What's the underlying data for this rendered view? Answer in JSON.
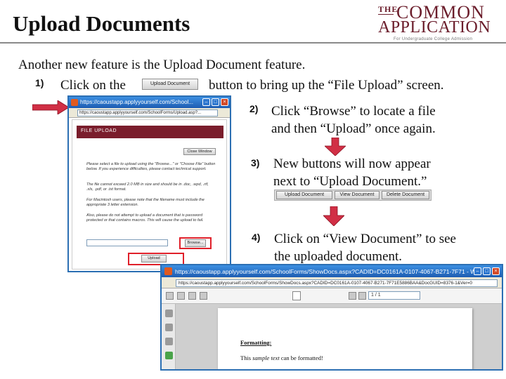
{
  "slide": {
    "title": "Upload Documents",
    "intro": "Another new feature is the Upload Document feature.",
    "step1": {
      "number": "1)",
      "text_before": "Click on the",
      "button_label": "Upload Document",
      "text_after": "button to bring up the “File Upload” screen."
    },
    "step2": {
      "number": "2)",
      "line1": "Click “Browse” to locate a file",
      "line2": "and then “Upload” once again."
    },
    "step3": {
      "number": "3)",
      "line1": "New buttons will now appear",
      "line2": "next to “Upload Document.”",
      "buttons": [
        "Upload Document",
        "View Document",
        "Delete Document"
      ]
    },
    "step4": {
      "number": "4)",
      "line1": "Click on “View Document” to see",
      "line2": "the uploaded document."
    }
  },
  "logo": {
    "the": "THE",
    "line1": "COMMON",
    "line2": "APPLICATION",
    "tagline": "For Undergraduate College Admission",
    "color": "#6b1d2b"
  },
  "file_upload_window": {
    "title": "https://caoustapp.applyyourself.com/School...",
    "address": "https://caoustapp.applyyourself.com/SchoolForms/Upload.asp?...",
    "header": "FILE UPLOAD",
    "close_button": "Close Window",
    "paragraphs": [
      "Please select a file to upload using the \"Browse...\" or \"Choose File\" button below. If you experience difficulties, please contact technical support.",
      "The file cannot exceed 2.0 MB in size and should be in .doc, .wpd, .rtf, .xls, .pdf, or .txt format.",
      "For Macintosh users, please note that the filename must include the appropriate 3 letter extension.",
      "Also, please do not attempt to upload a document that is password protected or that contains macros. This will cause the upload to fail."
    ],
    "browse_button": "Browse...",
    "upload_button": "Upload"
  },
  "view_document_window": {
    "title": "https://caoustapp.applyyourself.com/SchoolForms/ShowDocs.aspx?CADID=DC0161A-0107-4067-B271-7F71 - Wi...",
    "address": "https://caoustapp.applyyourself.com/SchoolForms/ShowDocs.aspx?CADID=DC0161A-0107-4067-B271-7F71E5886BAA&DocGUID=8376-1&Ver=0",
    "page_field": "1 / 1",
    "doc_heading": "Formatting:",
    "doc_text_before": "This ",
    "doc_text_italic": "sample text",
    "doc_text_after": " can be formatted!"
  }
}
